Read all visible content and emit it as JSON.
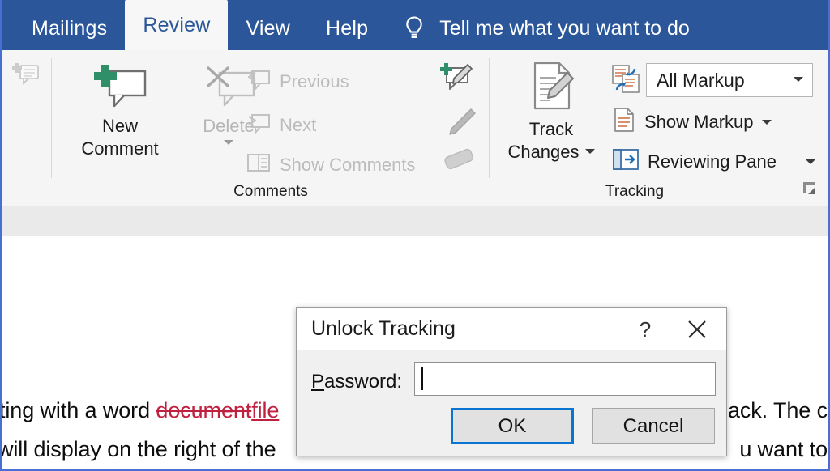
{
  "tabs": [
    {
      "label": "Mailings",
      "active": false
    },
    {
      "label": "Review",
      "active": true
    },
    {
      "label": "View",
      "active": false
    },
    {
      "label": "Help",
      "active": false
    }
  ],
  "tell_me": {
    "icon": "lightbulb-icon",
    "label": "Tell me what you want to do"
  },
  "ribbon": {
    "comments_group": {
      "label": "Comments",
      "new_comment": "New\nComment",
      "new_comment_line1": "New",
      "new_comment_line2": "Comment",
      "delete": "Delete",
      "previous": "Previous",
      "next": "Next",
      "show_comments": "Show Comments"
    },
    "ink_tools": {
      "new_ink_comment": "ink-comment-icon",
      "pen": "pen-icon",
      "eraser": "eraser-icon"
    },
    "tracking_group": {
      "label": "Tracking",
      "track_changes_line1": "Track",
      "track_changes_line2": "Changes",
      "display_for_review": "All Markup",
      "show_markup": "Show Markup",
      "reviewing_pane": "Reviewing Pane"
    }
  },
  "document": {
    "line1_pre": "ting with a word ",
    "line1_del": "document",
    "line1_ins": "file",
    "line1_tail": "ack. The c",
    "line2_pre": "will display on the right of the ",
    "line2_tail": "u want to"
  },
  "dialog": {
    "title": "Unlock Tracking",
    "help_glyph": "?",
    "close_glyph": "close-icon",
    "password_label_accel": "P",
    "password_label_rest": "assword:",
    "password_value": "",
    "password_placeholder": "",
    "ok_label": "OK",
    "cancel_label": "Cancel"
  },
  "colors": {
    "ribbon_blue": "#2b579a",
    "accent_focus": "#0a74d1",
    "markup_red": "#c0213f",
    "page_border": "#4a6fd4"
  }
}
